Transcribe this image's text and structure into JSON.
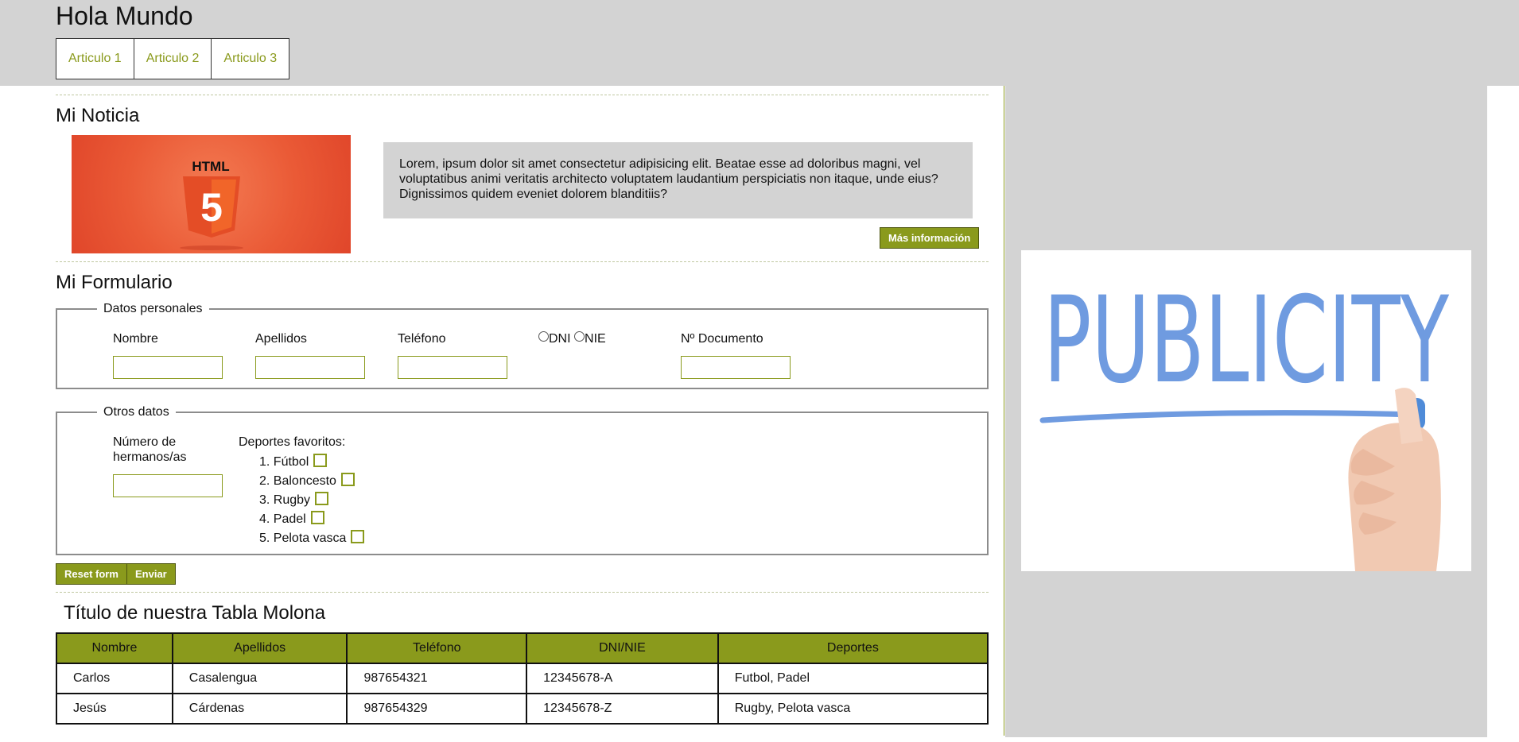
{
  "site": {
    "title": "Hola Mundo"
  },
  "nav": {
    "items": [
      "Articulo 1",
      "Articulo 2",
      "Articulo 3"
    ]
  },
  "news": {
    "heading": "Mi Noticia",
    "image_alt": "HTML 5 logo",
    "image_text": "HTML",
    "image_number": "5",
    "text": "Lorem, ipsum dolor sit amet consectetur adipisicing elit. Beatae esse ad doloribus magni, vel voluptatibus animi veritatis architecto voluptatem laudantium perspiciatis non itaque, unde eius? Dignissimos quidem eveniet dolorem blanditiis?",
    "more_button": "Más información"
  },
  "form": {
    "heading": "Mi Formulario",
    "personal": {
      "legend": "Datos personales",
      "nombre": "Nombre",
      "apellidos": "Apellidos",
      "telefono": "Teléfono",
      "dni": "DNI",
      "nie": "NIE",
      "documento": "Nº Documento"
    },
    "other": {
      "legend": "Otros datos",
      "siblings_line1": "Número de",
      "siblings_line2": "hermanos/as",
      "sports_label": "Deportes favoritos:",
      "sports": [
        "1. Fútbol",
        "2. Baloncesto",
        "3. Rugby",
        "4. Padel",
        "5. Pelota vasca"
      ]
    },
    "reset_button": "Reset form",
    "submit_button": "Enviar"
  },
  "table": {
    "title": "Título de nuestra Tabla Molona",
    "headers": [
      "Nombre",
      "Apellidos",
      "Teléfono",
      "DNI/NIE",
      "Deportes"
    ],
    "rows": [
      [
        "Carlos",
        "Casalengua",
        "987654321",
        "12345678-A",
        "Futbol, Padel"
      ],
      [
        "Jesús",
        "Cárdenas",
        "987654329",
        "12345678-Z",
        "Rugby, Pelota vasca"
      ]
    ]
  },
  "aside": {
    "ad_text": "PUBLICITY"
  },
  "colors": {
    "accent": "#8a9a1c",
    "panel": "#d3d3d3",
    "html5": "#e44d26",
    "publicity": "#6f9be0"
  }
}
